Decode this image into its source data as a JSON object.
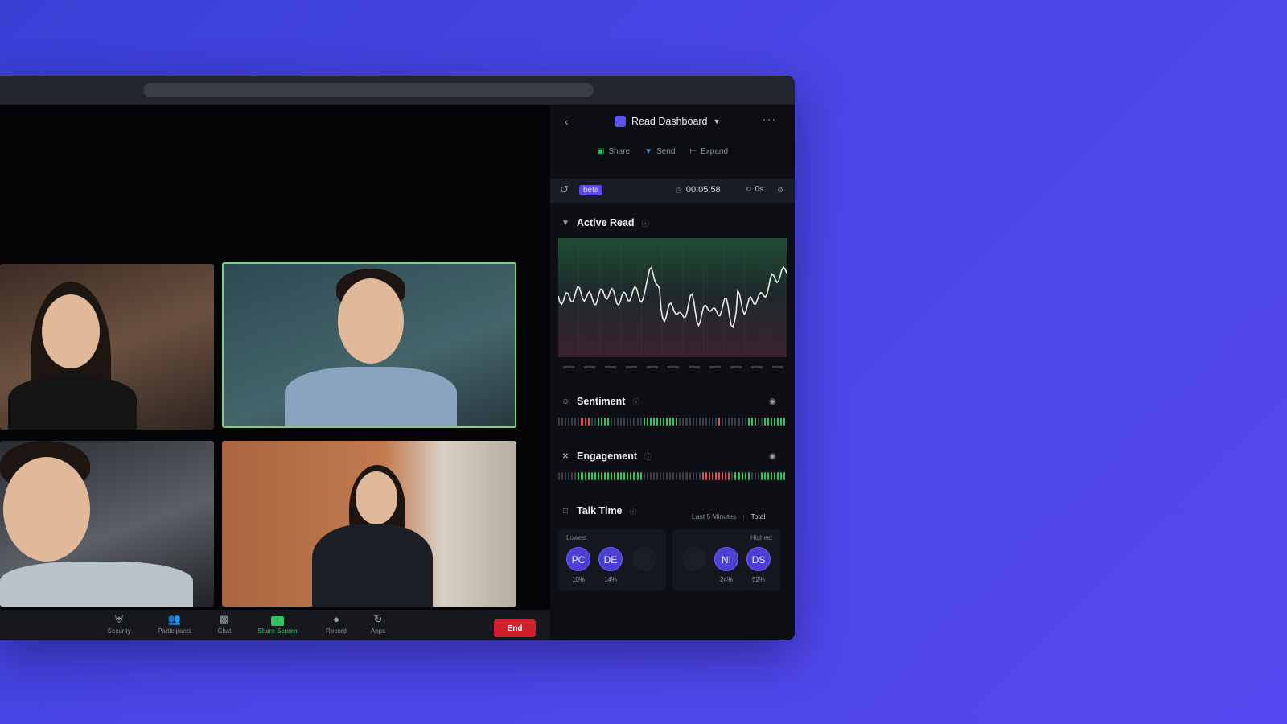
{
  "panel": {
    "title": "Read Dashboard",
    "actions": [
      {
        "label": "Share",
        "icon": "share-icon"
      },
      {
        "label": "Send",
        "icon": "filter-icon"
      },
      {
        "label": "Expand",
        "icon": "expand-icon"
      }
    ],
    "status": {
      "badge": "beta",
      "timer": "00:05:58",
      "counter": "0s"
    },
    "active_read": {
      "title": "Active Read"
    },
    "sentiment": {
      "title": "Sentiment"
    },
    "engagement": {
      "title": "Engagement"
    },
    "talk_time": {
      "title": "Talk Time",
      "ranges": [
        "Last 5 Minutes",
        "Total"
      ],
      "lowest_label": "Lowest",
      "highest_label": "Highest",
      "lowest": [
        {
          "initials": "PC",
          "pct": "10%"
        },
        {
          "initials": "DE",
          "pct": "14%"
        }
      ],
      "highest": [
        {
          "initials": "NI",
          "pct": "24%"
        },
        {
          "initials": "DS",
          "pct": "52%"
        }
      ]
    }
  },
  "toolbar": {
    "items": [
      {
        "label": "Security",
        "icon": "shield-icon"
      },
      {
        "label": "Participants",
        "icon": "participants-icon"
      },
      {
        "label": "Chat",
        "icon": "chat-icon"
      },
      {
        "label": "Share Screen",
        "icon": "share-screen-icon"
      },
      {
        "label": "Record",
        "icon": "record-icon"
      },
      {
        "label": "Apps",
        "icon": "apps-icon"
      }
    ],
    "end_label": "End"
  },
  "colors": {
    "accent": "#5a48e8",
    "positive": "#2fc463",
    "negative": "#e0505a",
    "end": "#d0202c",
    "active_speaker": "#7ed07a"
  }
}
